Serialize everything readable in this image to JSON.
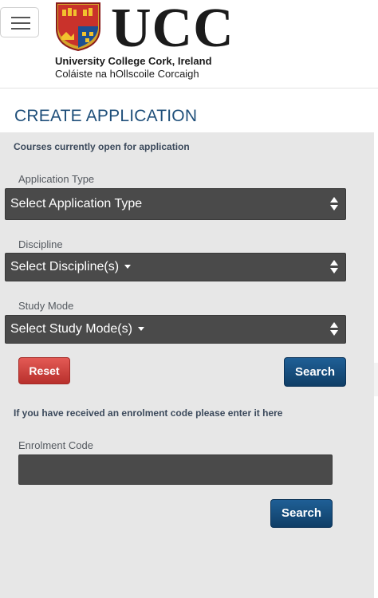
{
  "header": {
    "menu_icon": "hamburger-menu-icon",
    "logo": {
      "wordmark": "UCC",
      "name_en": "University College Cork, Ireland",
      "name_ga": "Coláiste na hOllscoile Corcaigh"
    }
  },
  "page": {
    "title": "CREATE APPLICATION"
  },
  "form": {
    "intro": "Courses currently open for application",
    "application_type": {
      "label": "Application Type",
      "value": "Select Application Type"
    },
    "discipline": {
      "label": "Discipline",
      "value": "Select Discipline(s)"
    },
    "study_mode": {
      "label": "Study Mode",
      "value": "Select Study Mode(s)"
    },
    "reset_label": "Reset",
    "search_label": "Search"
  },
  "enrolment": {
    "hint": "If you have received an enrolment code please enter it here",
    "label": "Enrolment Code",
    "value": "",
    "search_label": "Search"
  },
  "colors": {
    "title": "#1f4f7a",
    "panel": "#e7e7e7",
    "select_bg": "#4a4a4a",
    "reset_button": "#c8403b",
    "search_button": "#154b7a"
  }
}
